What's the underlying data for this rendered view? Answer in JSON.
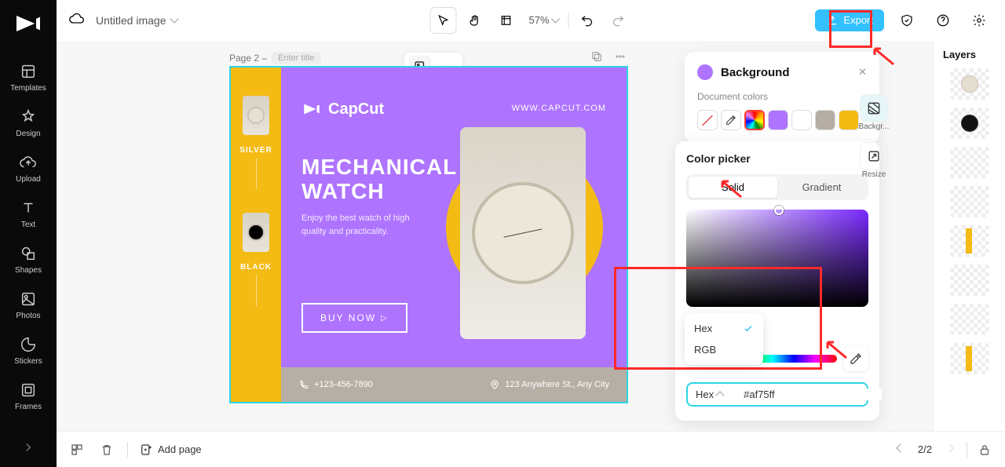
{
  "project_title": "Untitled image",
  "sidebar": {
    "items": [
      {
        "label": "Templates"
      },
      {
        "label": "Design"
      },
      {
        "label": "Upload"
      },
      {
        "label": "Text"
      },
      {
        "label": "Shapes"
      },
      {
        "label": "Photos"
      },
      {
        "label": "Stickers"
      },
      {
        "label": "Frames"
      }
    ]
  },
  "toolbar": {
    "zoom": "57%",
    "export_label": "Export"
  },
  "page": {
    "label": "Page 2 –",
    "title_placeholder": "Enter title"
  },
  "design": {
    "brand": "CapCut",
    "url": "WWW.CAPCUT.COM",
    "headline_l1": "MECHANICAL",
    "headline_l2": "WATCH",
    "subtext": "Enjoy the best watch of high quality and practicality.",
    "buy_label": "BUY NOW",
    "strip": {
      "silver": "SILVER",
      "black": "BLACK"
    },
    "phone": "+123-456-7890",
    "address": "123 Anywhere St., Any City"
  },
  "bg_panel": {
    "title": "Background",
    "doc_colors_label": "Document colors"
  },
  "picker": {
    "title": "Color picker",
    "tabs": {
      "solid": "Solid",
      "gradient": "Gradient"
    },
    "format_menu": {
      "hex": "Hex",
      "rgb": "RGB"
    },
    "format_selected": "Hex",
    "hex_value": "#af75ff"
  },
  "right_tools": {
    "background": "Backgr...",
    "resize": "Resize"
  },
  "layers": {
    "title": "Layers"
  },
  "bottombar": {
    "add_page": "Add page",
    "page_indicator": "2/2"
  }
}
